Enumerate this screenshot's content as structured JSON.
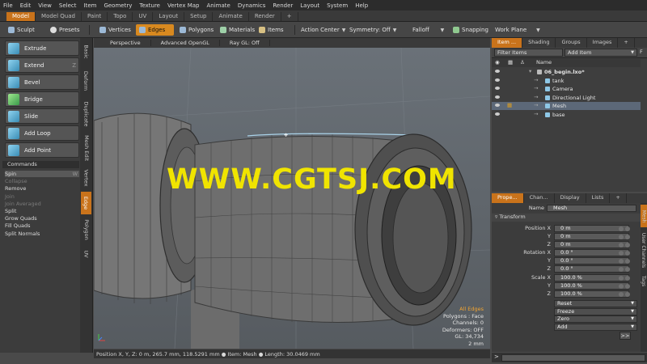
{
  "menu": [
    "File",
    "Edit",
    "View",
    "Select",
    "Item",
    "Geometry",
    "Texture",
    "Vertex Map",
    "Animate",
    "Dynamics",
    "Render",
    "Layout",
    "System",
    "Help"
  ],
  "layout_tabs": [
    "Model",
    "Model Quad",
    "Paint",
    "Topo",
    "UV",
    "Layout",
    "Setup",
    "Animate",
    "Render",
    "+"
  ],
  "toolbar": {
    "sculpt": "Sculpt",
    "presets": "Presets",
    "vertices": "Vertices",
    "edges": "Edges",
    "polygons": "Polygons",
    "materials": "Materials",
    "items": "Items",
    "action_center": "Action Center",
    "symmetry": "Symmetry: Off",
    "falloff": "Falloff",
    "snapping": "Snapping",
    "work_plane": "Work Plane"
  },
  "tools": [
    "Extrude",
    "Extend",
    "Bevel",
    "Bridge",
    "Slide",
    "Add Loop",
    "Add Point"
  ],
  "tool_shortcut": "Z",
  "left_vtabs": [
    "Basic",
    "Deform",
    "Duplicate",
    "Mesh Edit",
    "Vertex",
    "Edge",
    "Polygon",
    "UV"
  ],
  "commands_header": "Commands",
  "commands": [
    {
      "label": "Spin",
      "state": "sel"
    },
    {
      "label": "Collapse",
      "state": "dim"
    },
    {
      "label": "Remove",
      "state": ""
    },
    {
      "label": "Join",
      "state": "dim"
    },
    {
      "label": "Join Averaged",
      "state": "dim"
    },
    {
      "label": "Split",
      "state": ""
    },
    {
      "label": "Grow Quads",
      "state": ""
    },
    {
      "label": "Fill Quads",
      "state": ""
    },
    {
      "label": "Split Normals",
      "state": ""
    }
  ],
  "spin_shortcut": "W",
  "viewport": {
    "tabs": [
      "Perspective",
      "Advanced OpenGL",
      "Ray GL: Off"
    ],
    "watermark": "WWW.CGTSJ.COM",
    "info": {
      "mode": "All Edges",
      "polygons": "Polygons : Face",
      "channels": "Channels: 0",
      "deformers": "Deformers: OFF",
      "gl": "GL: 34,734",
      "size": "2 mm"
    },
    "status": "Position X, Y, Z:  0 m, 265.7 mm, 118.5291 mm ● Item:  Mesh ● Length:  30.0469 mm"
  },
  "item_panel": {
    "tabs": [
      "Item ...",
      "Shading",
      "Groups",
      "Images",
      "+"
    ],
    "filter": "Filter Items",
    "add_item": "Add Item",
    "col_name": "Name",
    "items": [
      {
        "label": "06_begin.lxo*",
        "indent": 0,
        "bold": true,
        "sel": false
      },
      {
        "label": "tank",
        "indent": 1,
        "bold": false,
        "sel": false
      },
      {
        "label": "Camera",
        "indent": 1,
        "bold": false,
        "sel": false
      },
      {
        "label": "Directional Light",
        "indent": 1,
        "bold": false,
        "sel": false
      },
      {
        "label": "Mesh",
        "indent": 1,
        "bold": false,
        "sel": true
      },
      {
        "label": "base",
        "indent": 1,
        "bold": false,
        "sel": false
      }
    ]
  },
  "props_panel": {
    "tabs": [
      "Prope...",
      "Chan...",
      "Display",
      "Lists",
      "+"
    ],
    "name_label": "Name",
    "name_value": "Mesh",
    "section": "Transform",
    "position_label": "Position X",
    "rotation_label": "Rotation X",
    "scale_label": "Scale X",
    "y_label": "Y",
    "z_label": "Z",
    "position": [
      "0 m",
      "0 m",
      "0 m"
    ],
    "rotation": [
      "0.0 °",
      "0.0 °",
      "0.0 °"
    ],
    "scale": [
      "100.0 %",
      "100.0 %",
      "100.0 %"
    ],
    "actions": [
      "Reset",
      "Freeze",
      "Zero",
      "Add"
    ],
    "more": ">>",
    "vtabs": [
      "Mesh",
      "User Channels",
      "Tags"
    ]
  }
}
